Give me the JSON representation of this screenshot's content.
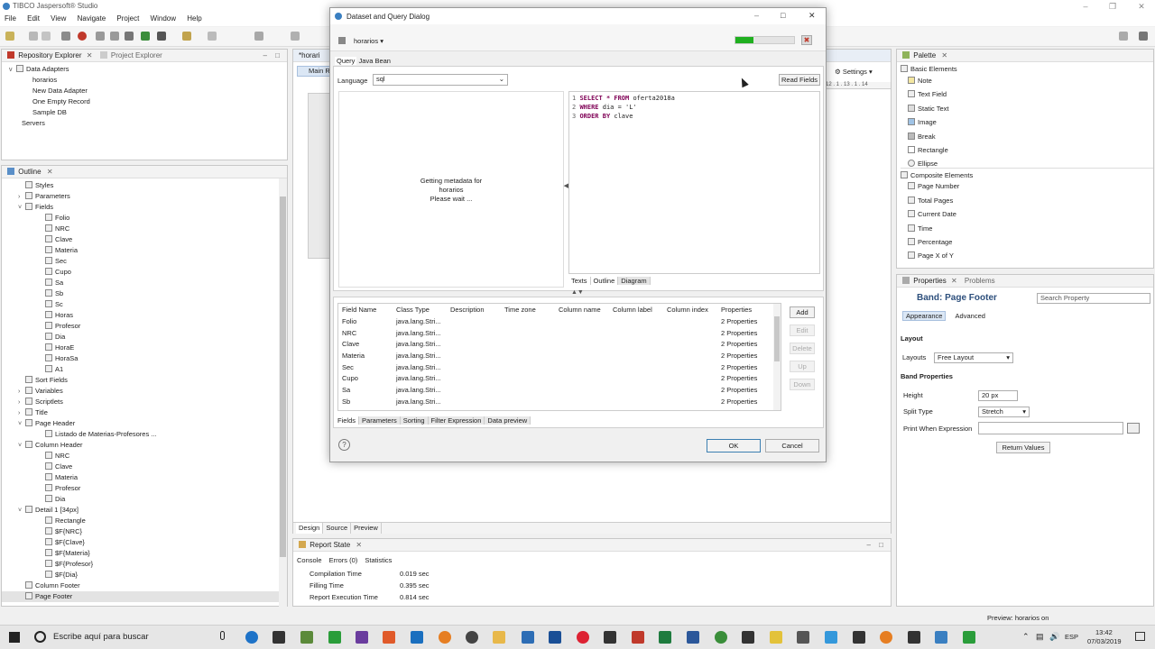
{
  "app": {
    "title": "TIBCO Jaspersoft® Studio",
    "menu": [
      "File",
      "Edit",
      "View",
      "Navigate",
      "Project",
      "Window",
      "Help"
    ]
  },
  "repository": {
    "tabs": [
      "Repository Explorer",
      "Project Explorer"
    ],
    "root": "Data Adapters",
    "items": [
      "horarios",
      "New Data Adapter",
      "One Empty Record",
      "Sample DB"
    ],
    "servers": "Servers"
  },
  "outline": {
    "title": "Outline",
    "nodes": [
      {
        "label": "Styles",
        "indent": 1,
        "arrow": ""
      },
      {
        "label": "Parameters",
        "indent": 1,
        "arrow": ">"
      },
      {
        "label": "Fields",
        "indent": 1,
        "arrow": "v"
      },
      {
        "label": "Folio",
        "indent": 2,
        "arrow": ""
      },
      {
        "label": "NRC",
        "indent": 2,
        "arrow": ""
      },
      {
        "label": "Clave",
        "indent": 2,
        "arrow": ""
      },
      {
        "label": "Materia",
        "indent": 2,
        "arrow": ""
      },
      {
        "label": "Sec",
        "indent": 2,
        "arrow": ""
      },
      {
        "label": "Cupo",
        "indent": 2,
        "arrow": ""
      },
      {
        "label": "Sa",
        "indent": 2,
        "arrow": ""
      },
      {
        "label": "Sb",
        "indent": 2,
        "arrow": ""
      },
      {
        "label": "Sc",
        "indent": 2,
        "arrow": ""
      },
      {
        "label": "Horas",
        "indent": 2,
        "arrow": ""
      },
      {
        "label": "Profesor",
        "indent": 2,
        "arrow": ""
      },
      {
        "label": "Dia",
        "indent": 2,
        "arrow": ""
      },
      {
        "label": "HoraE",
        "indent": 2,
        "arrow": ""
      },
      {
        "label": "HoraSa",
        "indent": 2,
        "arrow": ""
      },
      {
        "label": "A1",
        "indent": 2,
        "arrow": ""
      },
      {
        "label": "Sort Fields",
        "indent": 1,
        "arrow": ""
      },
      {
        "label": "Variables",
        "indent": 1,
        "arrow": ">"
      },
      {
        "label": "Scriptlets",
        "indent": 1,
        "arrow": ">"
      },
      {
        "label": "Title",
        "indent": 1,
        "arrow": ">"
      },
      {
        "label": "Page Header",
        "indent": 1,
        "arrow": "v"
      },
      {
        "label": "Listado de Materias-Profesores ...",
        "indent": 2,
        "arrow": ""
      },
      {
        "label": "Column Header",
        "indent": 1,
        "arrow": "v"
      },
      {
        "label": "NRC",
        "indent": 2,
        "arrow": ""
      },
      {
        "label": "Clave",
        "indent": 2,
        "arrow": ""
      },
      {
        "label": "Materia",
        "indent": 2,
        "arrow": ""
      },
      {
        "label": "Profesor",
        "indent": 2,
        "arrow": ""
      },
      {
        "label": "Dia",
        "indent": 2,
        "arrow": ""
      },
      {
        "label": "Detail 1 [34px]",
        "indent": 1,
        "arrow": "v"
      },
      {
        "label": "Rectangle",
        "indent": 2,
        "arrow": ""
      },
      {
        "label": "$F{NRC}",
        "indent": 2,
        "arrow": ""
      },
      {
        "label": "$F{Clave}",
        "indent": 2,
        "arrow": ""
      },
      {
        "label": "$F{Materia}",
        "indent": 2,
        "arrow": ""
      },
      {
        "label": "$F{Profesor}",
        "indent": 2,
        "arrow": ""
      },
      {
        "label": "$F{Dia}",
        "indent": 2,
        "arrow": ""
      },
      {
        "label": "Column Footer",
        "indent": 1,
        "arrow": ""
      },
      {
        "label": "Page Footer",
        "indent": 1,
        "arrow": ""
      }
    ]
  },
  "editor": {
    "tab": "*horari",
    "subtab": "Main R",
    "bottom_tabs": [
      "Design",
      "Source",
      "Preview"
    ],
    "settings_label": "Settings"
  },
  "dialog": {
    "title": "Dataset and Query Dialog",
    "dataset": "horarios",
    "tabs": [
      "Query",
      "Java Bean"
    ],
    "language_label": "Language",
    "language_value": "sql",
    "read_fields": "Read Fields",
    "metadata_msg": [
      "Getting metadata for",
      "horarios",
      "Please wait ..."
    ],
    "query_lines": [
      {
        "num": "1",
        "kw": "SELECT * FROM",
        "rest": " oferta2018a"
      },
      {
        "num": "2",
        "kw": "WHERE",
        "rest": " dia = 'L'"
      },
      {
        "num": "3",
        "kw": "ORDER BY",
        "rest": " clave"
      }
    ],
    "query_tabs": [
      "Texts",
      "Outline",
      "Diagram"
    ],
    "columns": [
      "Field Name",
      "Class Type",
      "Description",
      "Time zone",
      "Column name",
      "Column label",
      "Column index",
      "Properties"
    ],
    "rows": [
      {
        "name": "Folio",
        "cls": "java.lang.Stri...",
        "props": "2 Properties"
      },
      {
        "name": "NRC",
        "cls": "java.lang.Stri...",
        "props": "2 Properties"
      },
      {
        "name": "Clave",
        "cls": "java.lang.Stri...",
        "props": "2 Properties"
      },
      {
        "name": "Materia",
        "cls": "java.lang.Stri...",
        "props": "2 Properties"
      },
      {
        "name": "Sec",
        "cls": "java.lang.Stri...",
        "props": "2 Properties"
      },
      {
        "name": "Cupo",
        "cls": "java.lang.Stri...",
        "props": "2 Properties"
      },
      {
        "name": "Sa",
        "cls": "java.lang.Stri...",
        "props": "2 Properties"
      },
      {
        "name": "Sb",
        "cls": "java.lang.Stri...",
        "props": "2 Properties"
      }
    ],
    "side_buttons": [
      "Add",
      "Edit",
      "Delete",
      "Up",
      "Down"
    ],
    "bottom_tabs": [
      "Fields",
      "Parameters",
      "Sorting",
      "Filter Expression",
      "Data preview"
    ],
    "ok": "OK",
    "cancel": "Cancel",
    "help": "?"
  },
  "palette": {
    "title": "Palette",
    "basic_header": "Basic Elements",
    "basic": [
      "Note",
      "Text Field",
      "Static Text",
      "Image",
      "Break",
      "Rectangle",
      "Ellipse"
    ],
    "composite_header": "Composite Elements",
    "composite": [
      "Page Number",
      "Total Pages",
      "Current Date",
      "Time",
      "Percentage",
      "Page X of Y"
    ]
  },
  "properties": {
    "tabs": [
      "Properties",
      "Problems"
    ],
    "band_title": "Band: Page Footer",
    "search_placeholder": "Search Property",
    "subtabs": [
      "Appearance",
      "Advanced"
    ],
    "layout_section": "Layout",
    "layouts_label": "Layouts",
    "layouts_value": "Free Layout",
    "band_section": "Band Properties",
    "height_label": "Height",
    "height_value": "20 px",
    "split_label": "Split Type",
    "split_value": "Stretch",
    "print_label": "Print When Expression",
    "return_values": "Return Values"
  },
  "report_state": {
    "title": "Report State",
    "tabs": [
      "Console",
      "Errors (0)",
      "Statistics"
    ],
    "rows": [
      {
        "label": "Compilation Time",
        "value": "0.019 sec"
      },
      {
        "label": "Filling Time",
        "value": "0.395 sec"
      },
      {
        "label": "Report Execution Time",
        "value": "0.814 sec"
      }
    ]
  },
  "status": {
    "preview": "Preview: horarios on"
  },
  "taskbar": {
    "search": "Escribe aquí para buscar",
    "lang": "ESP",
    "time": "13:42",
    "date": "07/03/2019"
  }
}
